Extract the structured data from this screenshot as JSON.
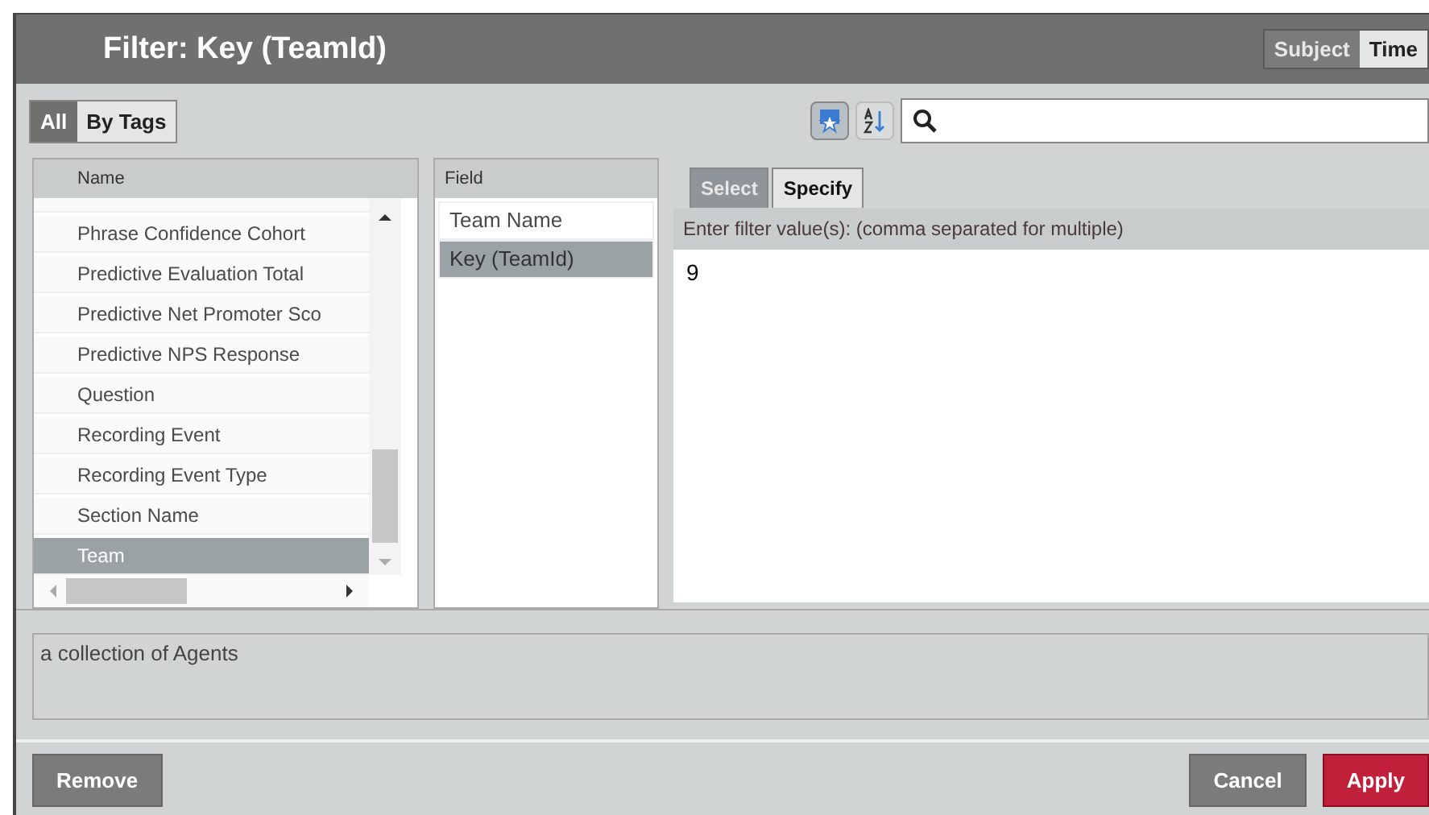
{
  "window": {
    "title": "Filter: Key (TeamId)"
  },
  "view_tabs": [
    {
      "label": "Subject",
      "selected": false
    },
    {
      "label": "Time",
      "selected": true
    }
  ],
  "filter_tabs": [
    {
      "label": "All",
      "selected": true
    },
    {
      "label": "By Tags",
      "selected": false
    }
  ],
  "name_list": {
    "header": "Name",
    "items": [
      {
        "label": "Phrase Confidence Cohort",
        "selected": false
      },
      {
        "label": "Predictive Evaluation Total",
        "selected": false
      },
      {
        "label": "Predictive Net Promoter Sco",
        "selected": false
      },
      {
        "label": "Predictive NPS Response",
        "selected": false
      },
      {
        "label": "Question",
        "selected": false
      },
      {
        "label": "Recording Event",
        "selected": false
      },
      {
        "label": "Recording Event Type",
        "selected": false
      },
      {
        "label": "Section Name",
        "selected": false
      },
      {
        "label": "Team",
        "selected": true
      }
    ]
  },
  "field_list": {
    "header": "Field",
    "items": [
      {
        "label": "Team Name",
        "selected": false
      },
      {
        "label": "Key (TeamId)",
        "selected": true
      }
    ]
  },
  "value_tabs": [
    {
      "label": "Select",
      "selected": false
    },
    {
      "label": "Specify",
      "selected": true
    }
  ],
  "prompt": "Enter filter value(s): (comma separated for multiple)",
  "value_input": {
    "value": "9"
  },
  "description": "a collection of Agents",
  "buttons": [
    {
      "label": "Remove",
      "kind": "secondary"
    },
    {
      "label": "Cancel",
      "kind": "secondary"
    },
    {
      "label": "Apply",
      "kind": "primary"
    }
  ]
}
